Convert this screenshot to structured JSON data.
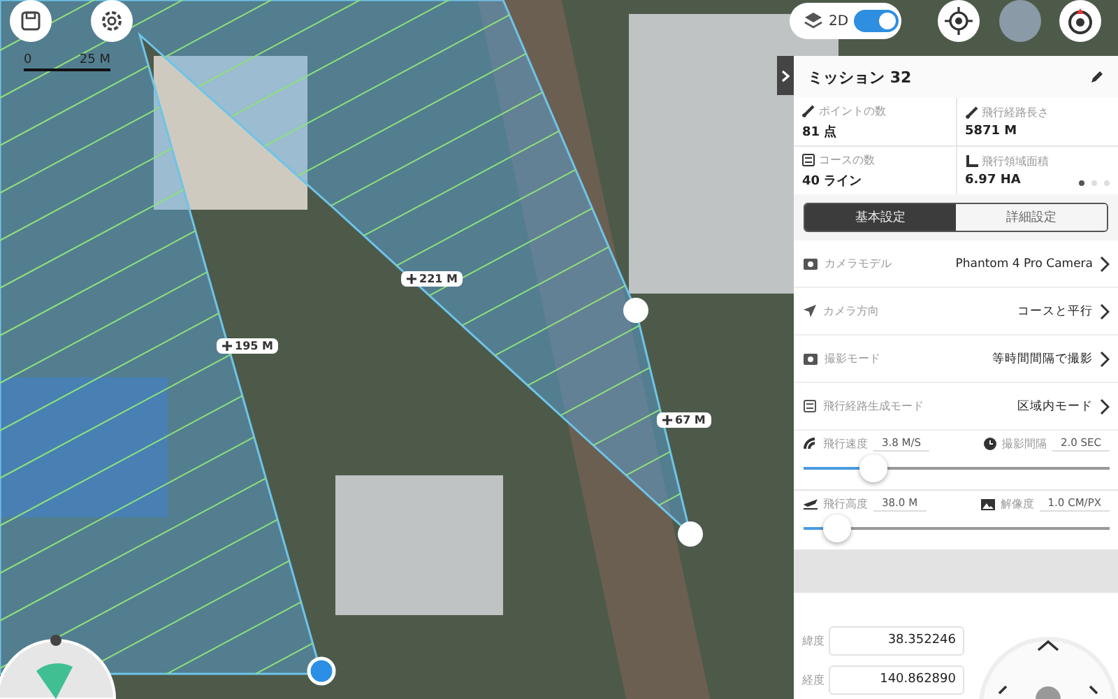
{
  "map": {
    "scale": {
      "start": "0",
      "end": "25 M"
    },
    "distance_labels": [
      {
        "text": "221 M"
      },
      {
        "text": "195 M"
      },
      {
        "text": "67 M"
      }
    ],
    "layer_toggle": {
      "label": "2D",
      "on": true
    }
  },
  "panel": {
    "title": "ミッション 32",
    "stats": [
      {
        "kind": "points",
        "label": "ポイントの数",
        "value": "81 点"
      },
      {
        "kind": "length",
        "label": "飛行経路長さ",
        "value": "5871 M"
      },
      {
        "kind": "courses",
        "label": "コースの数",
        "value": "40 ライン"
      },
      {
        "kind": "area",
        "label": "飛行領域面積",
        "value": "6.97 HA"
      }
    ],
    "page_dots": [
      {
        "selected": true
      },
      {
        "selected": false
      },
      {
        "selected": false
      }
    ],
    "tabs": [
      {
        "label": "基本設定",
        "selected": true
      },
      {
        "label": "詳細設定",
        "selected": false
      }
    ],
    "settings": [
      {
        "kind": "camera",
        "label": "カメラモデル",
        "value": "Phantom 4 Pro Camera"
      },
      {
        "kind": "direction",
        "label": "カメラ方向",
        "value": "コースと平行"
      },
      {
        "kind": "shoot",
        "label": "撮影モード",
        "value": "等時間間隔で撮影"
      },
      {
        "kind": "route",
        "label": "飛行経路生成モード",
        "value": "区域内モード"
      }
    ],
    "sliders": [
      {
        "kind": "speed",
        "label": "飛行速度",
        "value": "3.8 M/S",
        "side": {
          "kind": "interval",
          "label": "撮影間隔",
          "value": "2.0 SEC"
        },
        "level": 0.23
      },
      {
        "kind": "altitude",
        "label": "飛行高度",
        "value": "38.0 M",
        "side": {
          "kind": "resolution",
          "label": "解像度",
          "value": "1.0 CM/PX"
        },
        "level": 0.11
      }
    ],
    "coordinates": [
      {
        "label": "緯度",
        "value": "38.352246"
      },
      {
        "label": "経度",
        "value": "140.862890"
      }
    ]
  }
}
